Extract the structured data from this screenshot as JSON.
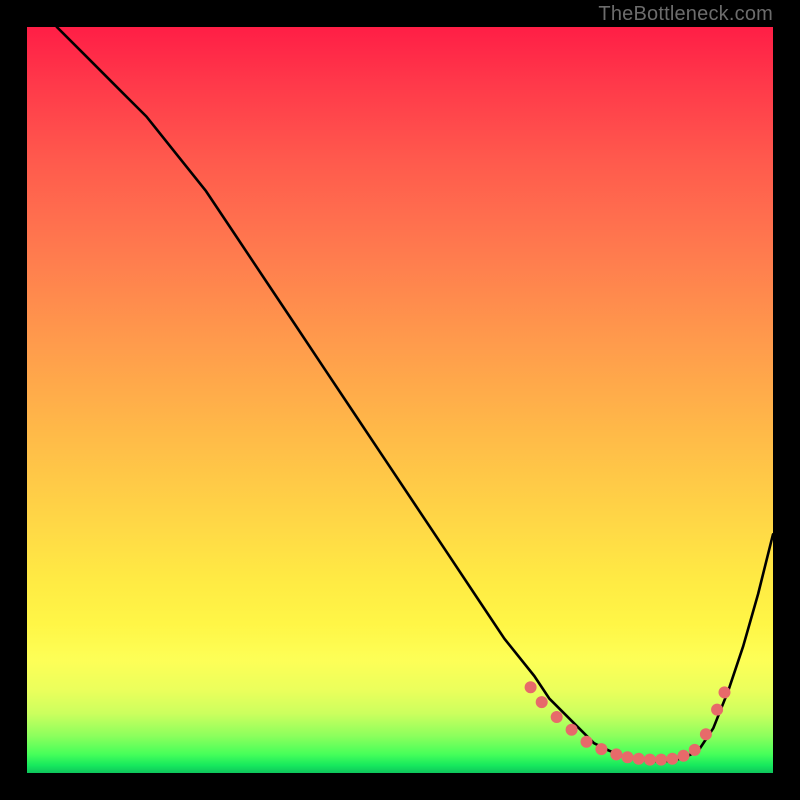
{
  "watermark": "TheBottleneck.com",
  "colors": {
    "dot": "#e76a6a",
    "line": "#000000"
  },
  "chart_data": {
    "type": "line",
    "title": "",
    "xlabel": "",
    "ylabel": "",
    "xlim": [
      0,
      100
    ],
    "ylim": [
      0,
      100
    ],
    "grid": false,
    "legend": false,
    "series": [
      {
        "name": "curve",
        "x": [
          4,
          8,
          12,
          16,
          20,
          24,
          28,
          32,
          36,
          40,
          44,
          48,
          52,
          56,
          60,
          64,
          68,
          70,
          72,
          74,
          76,
          78,
          80,
          82,
          84,
          86,
          88,
          90,
          92,
          94,
          96,
          98,
          100
        ],
        "y": [
          100,
          96,
          92,
          88,
          83,
          78,
          72,
          66,
          60,
          54,
          48,
          42,
          36,
          30,
          24,
          18,
          13,
          10,
          8,
          6,
          4,
          3,
          2.2,
          1.8,
          1.6,
          1.6,
          2,
          3,
          6,
          11,
          17,
          24,
          32
        ]
      }
    ],
    "highlight_points": {
      "name": "sweet-spot-dots",
      "x": [
        67.5,
        69,
        71,
        73,
        75,
        77,
        79,
        80.5,
        82,
        83.5,
        85,
        86.5,
        88,
        89.5,
        91,
        92.5,
        93.5
      ],
      "y": [
        11.5,
        9.5,
        7.5,
        5.8,
        4.2,
        3.2,
        2.5,
        2.1,
        1.9,
        1.8,
        1.8,
        1.9,
        2.3,
        3.1,
        5.2,
        8.5,
        10.8
      ]
    }
  }
}
